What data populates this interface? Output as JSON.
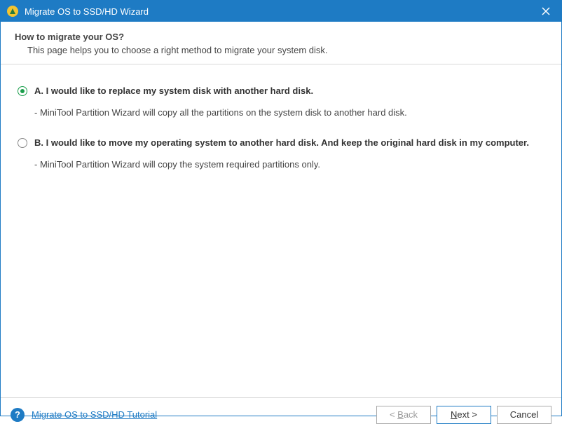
{
  "titlebar": {
    "title": "Migrate OS to SSD/HD Wizard"
  },
  "header": {
    "title": "How to migrate your OS?",
    "subtitle": "This page helps you to choose a right method to migrate your system disk."
  },
  "options": {
    "a": {
      "label": "A. I would like to replace my system disk with another hard disk.",
      "desc": "- MiniTool Partition Wizard will copy all the partitions on the system disk to another hard disk.",
      "selected": true
    },
    "b": {
      "label": "B. I would like to move my operating system to another hard disk. And keep the original hard disk in my computer.",
      "desc": "- MiniTool Partition Wizard will copy the system required partitions only.",
      "selected": false
    }
  },
  "footer": {
    "tutorial_link": "Migrate OS to SSD/HD Tutorial",
    "back_prefix": "< ",
    "back_mnemonic": "B",
    "back_suffix": "ack",
    "next_mnemonic": "N",
    "next_suffix": "ext >",
    "cancel": "Cancel"
  }
}
